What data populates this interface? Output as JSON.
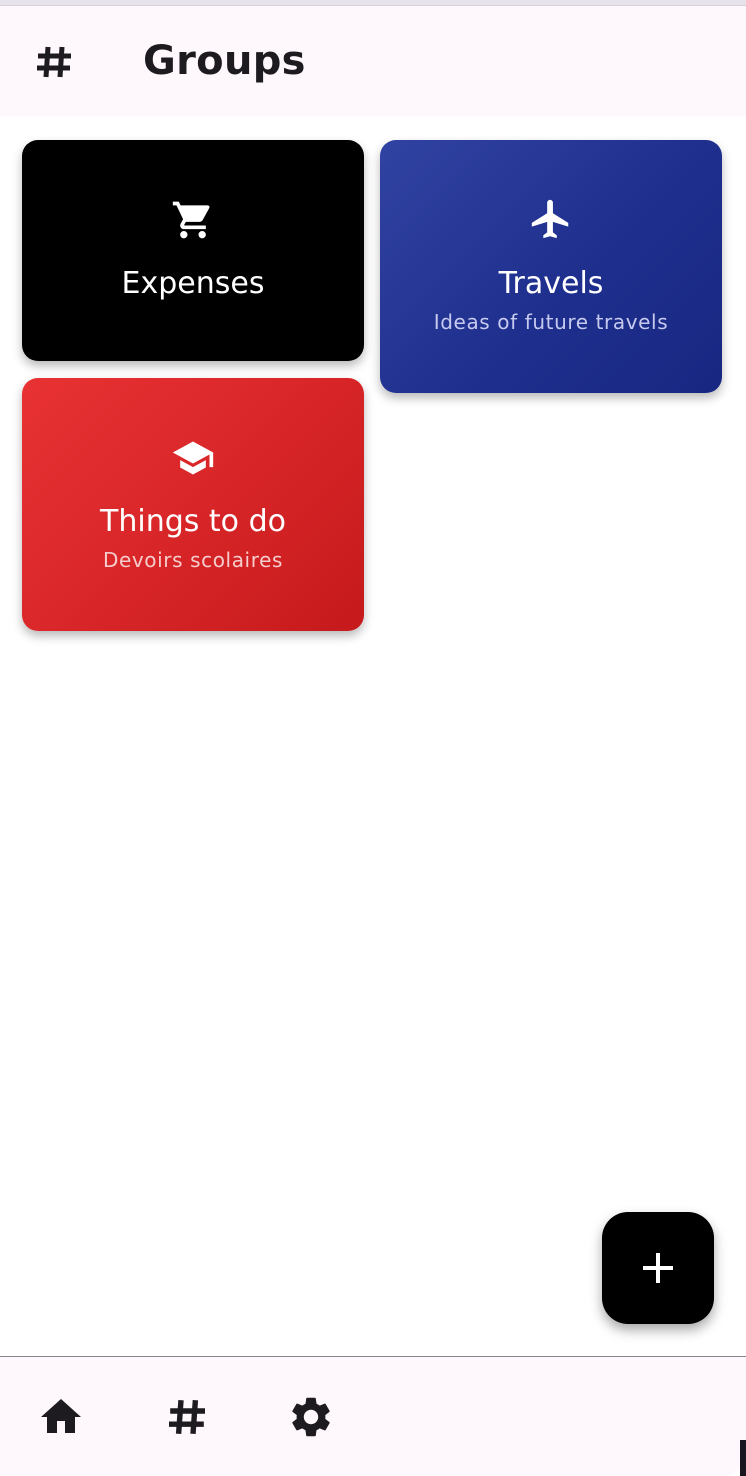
{
  "appbar": {
    "title": "Groups",
    "leading_icon": "hashtag-icon"
  },
  "groups": [
    {
      "title": "Expenses",
      "subtitle": "",
      "icon": "shopping-cart-icon",
      "color": "#000000"
    },
    {
      "title": "Travels",
      "subtitle": "Ideas of future travels",
      "icon": "airplane-icon",
      "color": "#1f2f8e"
    },
    {
      "title": "Things to do",
      "subtitle": "Devoirs scolaires",
      "icon": "graduation-cap-icon",
      "color": "#d72527"
    }
  ],
  "fab": {
    "icon": "plus-icon",
    "color": "#000000"
  },
  "bottom_nav": [
    {
      "icon": "home-icon"
    },
    {
      "icon": "hashtag-icon"
    },
    {
      "icon": "settings-gear-icon"
    }
  ],
  "colors": {
    "bar_background": "#fef7fb",
    "text_primary": "#1d1b20",
    "travels_subtitle": "#c6caef",
    "todo_subtitle": "#f6cccc"
  }
}
